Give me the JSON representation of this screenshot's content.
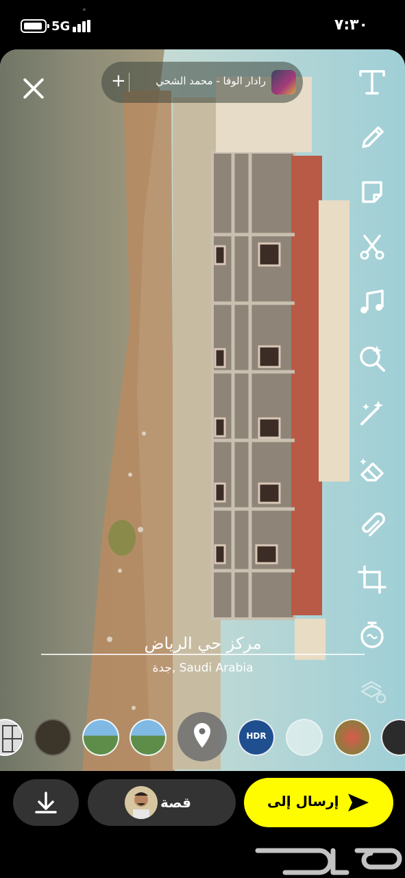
{
  "status_bar": {
    "network": "5G",
    "time": "٧:٣٠"
  },
  "music": {
    "add_symbol": "+",
    "title": "رادار الوفا - محمد الشحي"
  },
  "toolbar": {
    "icons": [
      "text-icon",
      "pencil-icon",
      "sticker-icon",
      "scissors-icon",
      "music-note-icon",
      "lens-search-icon",
      "magic-wand-icon",
      "eraser-icon",
      "paperclip-icon",
      "crop-icon",
      "timer-icon",
      "more-tools-icon"
    ]
  },
  "caption": {
    "title": "مركز حي الرياض",
    "subtitle": "جدة, Saudi Arabia"
  },
  "lenses": {
    "hdr_label": "HDR"
  },
  "bottom_bar": {
    "story_label": "قصة",
    "send_label": "إرسال إلى"
  },
  "colors": {
    "send_button": "#fffc00",
    "pill_background": "#333333",
    "background": "#000000"
  }
}
